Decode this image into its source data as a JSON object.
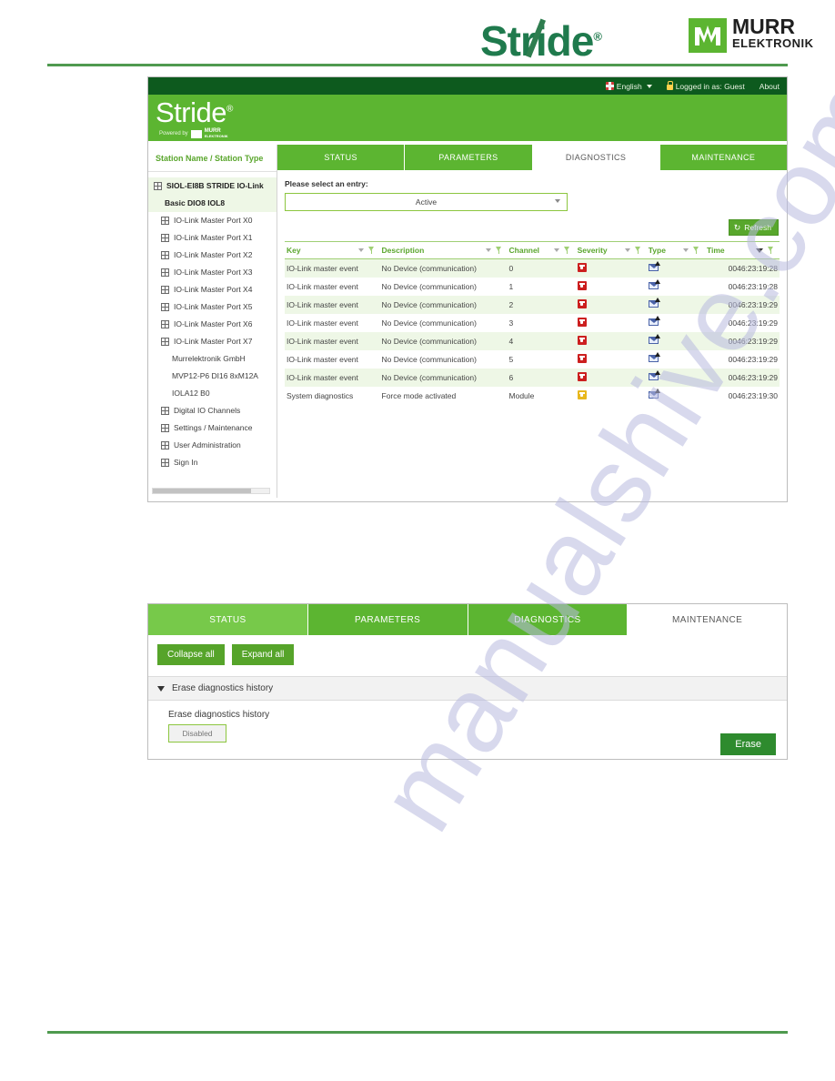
{
  "doc": {
    "brand_stride": "Stride",
    "brand_tm": "®",
    "murr_line1": "MURR",
    "murr_line2": "ELEKTRONIK",
    "watermark": "manualshive.com"
  },
  "colors": {
    "header_green": "#5cb531",
    "dark_green": "#0d5a1e",
    "accent_green": "#5aa62d",
    "row_alt": "#eef7e6",
    "severity_error": "#cc1f1f",
    "severity_warning": "#e8b81e",
    "type_icon": "#4a63a8"
  },
  "shot1": {
    "topbar": {
      "language": "English",
      "language_icon": "flag-icon",
      "login_status": "Logged in as: Guest",
      "login_icon": "lock-icon",
      "about": "About"
    },
    "appheader": {
      "logo": "Stride",
      "logo_tm": "®",
      "powered_by": "Powered by",
      "powered_brand_line1": "MURR",
      "powered_brand_line2": "ELEKTRONIK"
    },
    "sidebar": {
      "header": "Station Name / Station Type",
      "items": [
        {
          "label": "SIOL-EI8B STRIDE IO-Link",
          "level": "root",
          "icon": "node-icon"
        },
        {
          "label": "Basic DIO8 IOL8",
          "level": "root-2",
          "icon": ""
        },
        {
          "label": "IO-Link Master Port X0",
          "level": "lvl2",
          "icon": "node-icon"
        },
        {
          "label": "IO-Link Master Port X1",
          "level": "lvl2",
          "icon": "node-icon"
        },
        {
          "label": "IO-Link Master Port X2",
          "level": "lvl2",
          "icon": "node-icon"
        },
        {
          "label": "IO-Link Master Port X3",
          "level": "lvl2",
          "icon": "node-icon"
        },
        {
          "label": "IO-Link Master Port X4",
          "level": "lvl2",
          "icon": "node-icon"
        },
        {
          "label": "IO-Link Master Port X5",
          "level": "lvl2",
          "icon": "node-icon"
        },
        {
          "label": "IO-Link Master Port X6",
          "level": "lvl2",
          "icon": "node-icon"
        },
        {
          "label": "IO-Link Master Port X7",
          "level": "lvl2",
          "icon": "node-icon"
        },
        {
          "label": "Murrelektronik GmbH",
          "level": "lvl3",
          "icon": ""
        },
        {
          "label": "MVP12-P6 DI16 8xM12A",
          "level": "lvl3",
          "icon": ""
        },
        {
          "label": "IOLA12 B0",
          "level": "lvl3",
          "icon": ""
        },
        {
          "label": "Digital IO Channels",
          "level": "lvl2",
          "icon": "node-icon"
        },
        {
          "label": "Settings / Maintenance",
          "level": "lvl2",
          "icon": "node-icon"
        },
        {
          "label": "User Administration",
          "level": "lvl2",
          "icon": "node-icon"
        },
        {
          "label": "Sign In",
          "level": "lvl2",
          "icon": "node-icon"
        }
      ]
    },
    "tabs": [
      {
        "label": "STATUS",
        "state": "normal"
      },
      {
        "label": "PARAMETERS",
        "state": "normal"
      },
      {
        "label": "DIAGNOSTICS",
        "state": "active"
      },
      {
        "label": "MAINTENANCE",
        "state": "normal"
      }
    ],
    "select_label": "Please select an entry:",
    "select_value": "Active",
    "refresh_label": "Refresh",
    "refresh_icon": "refresh-icon",
    "table": {
      "columns": [
        "Key",
        "Description",
        "Channel",
        "Severity",
        "Type",
        "Time"
      ],
      "rows": [
        {
          "key": "IO-Link master event",
          "description": "No Device (communication)",
          "channel": "0",
          "severity": "error",
          "type": "event-icon",
          "time": "0046:23:19:28"
        },
        {
          "key": "IO-Link master event",
          "description": "No Device (communication)",
          "channel": "1",
          "severity": "error",
          "type": "event-icon",
          "time": "0046:23:19:28"
        },
        {
          "key": "IO-Link master event",
          "description": "No Device (communication)",
          "channel": "2",
          "severity": "error",
          "type": "event-icon",
          "time": "0046:23:19:29"
        },
        {
          "key": "IO-Link master event",
          "description": "No Device (communication)",
          "channel": "3",
          "severity": "error",
          "type": "event-icon",
          "time": "0046:23:19:29"
        },
        {
          "key": "IO-Link master event",
          "description": "No Device (communication)",
          "channel": "4",
          "severity": "error",
          "type": "event-icon",
          "time": "0046:23:19:29"
        },
        {
          "key": "IO-Link master event",
          "description": "No Device (communication)",
          "channel": "5",
          "severity": "error",
          "type": "event-icon",
          "time": "0046:23:19:29"
        },
        {
          "key": "IO-Link master event",
          "description": "No Device (communication)",
          "channel": "6",
          "severity": "error",
          "type": "event-icon",
          "time": "0046:23:19:29"
        },
        {
          "key": "System diagnostics",
          "description": "Force mode activated",
          "channel": "Module",
          "severity": "warning",
          "type": "event-icon",
          "time": "0046:23:19:30"
        }
      ]
    }
  },
  "shot2": {
    "tabs": [
      {
        "label": "STATUS",
        "state": "hover"
      },
      {
        "label": "PARAMETERS",
        "state": "normal"
      },
      {
        "label": "DIAGNOSTICS",
        "state": "normal"
      },
      {
        "label": "MAINTENANCE",
        "state": "active"
      }
    ],
    "collapse_all": "Collapse all",
    "expand_all": "Expand all",
    "section_title": "Erase diagnostics history",
    "field_label": "Erase diagnostics history",
    "field_value": "Disabled",
    "erase_button": "Erase"
  }
}
